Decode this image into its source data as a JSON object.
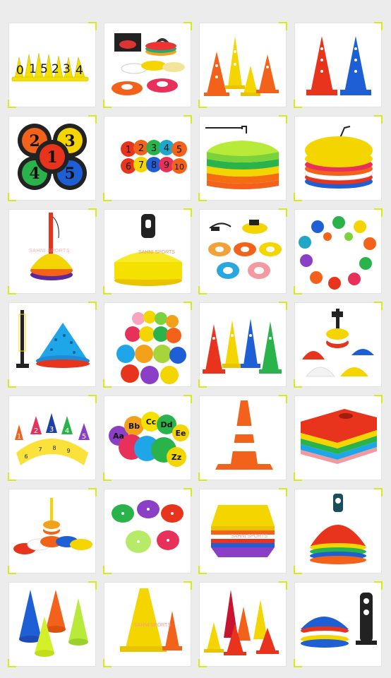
{
  "accent_color": "#d6ea1e",
  "grid": {
    "columns": 4,
    "rows": 7
  },
  "watermark_logo": "SAHNI SPORTS",
  "tiles": [
    {
      "name": "numbered-cones",
      "labels": [
        "0",
        "1",
        "5",
        "2",
        "3",
        "4"
      ]
    },
    {
      "name": "disc-cones-in-carry-bag"
    },
    {
      "name": "tall-hurdle-cones"
    },
    {
      "name": "tall-cones-red-blue"
    },
    {
      "name": "numbered-rubber-spots",
      "labels": [
        "2",
        "3",
        "1",
        "4",
        "5"
      ]
    },
    {
      "name": "numbered-flat-markers",
      "labels": [
        "1",
        "2",
        "3",
        "4",
        "5",
        "6",
        "7",
        "8",
        "9",
        "10"
      ]
    },
    {
      "name": "flat-marker-stack-with-stand"
    },
    {
      "name": "round-marker-stack-with-stand"
    },
    {
      "name": "disc-cone-stack-with-pole"
    },
    {
      "name": "yellow-disc-cones-with-holder"
    },
    {
      "name": "dome-cones-with-whistle"
    },
    {
      "name": "hand-shaped-markers"
    },
    {
      "name": "agility-pole-with-hole-cone"
    },
    {
      "name": "round-flat-markers-colors"
    },
    {
      "name": "tall-agility-cones-set"
    },
    {
      "name": "dome-cones-with-pole"
    },
    {
      "name": "numbered-cones-arc",
      "labels": [
        "1",
        "2",
        "3",
        "4",
        "5",
        "6",
        "7",
        "8",
        "9"
      ]
    },
    {
      "name": "alphabet-spot-markers",
      "labels": [
        "Aa",
        "Bb",
        "Cc",
        "Dd",
        "Ee",
        "Zz"
      ]
    },
    {
      "name": "orange-traffic-cone"
    },
    {
      "name": "hexagon-cone-stack"
    },
    {
      "name": "dome-cones-with-pole-set"
    },
    {
      "name": "flat-spot-markers-pastel"
    },
    {
      "name": "hexagon-flat-markers"
    },
    {
      "name": "dome-cones-with-carry-handle"
    },
    {
      "name": "tall-cone-stacks"
    },
    {
      "name": "yellow-tall-cones"
    },
    {
      "name": "small-traffic-cones"
    },
    {
      "name": "dome-cones-with-holder"
    }
  ]
}
